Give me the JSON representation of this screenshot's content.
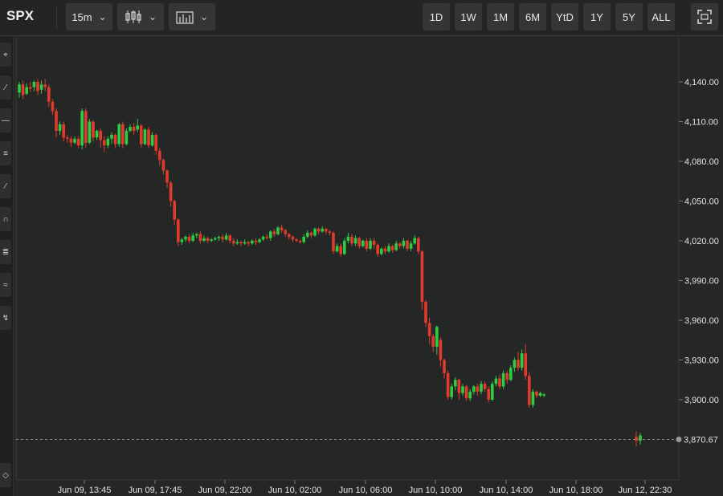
{
  "toolbar": {
    "symbol": "SPX",
    "interval": "15m",
    "candle_icon": "candlestick-icon",
    "indicator_icon": "indicators-icon",
    "ranges": [
      "1D",
      "1W",
      "1M",
      "6M",
      "YtD",
      "1Y",
      "5Y",
      "ALL"
    ],
    "fullscreen_icon": "fullscreen-icon"
  },
  "sidebar": {
    "tools": [
      "crosshair-icon",
      "trendline-icon",
      "horizontal-line-icon",
      "fibonacci-icon",
      "channel-icon",
      "arc-icon",
      "pitchfork-icon",
      "brush-icon",
      "annotation-icon"
    ],
    "bottom_tool": "eraser-icon"
  },
  "colors": {
    "up": "#2ecc40",
    "down": "#e23b2e",
    "background": "#252726"
  },
  "chart_data": {
    "type": "candlestick",
    "symbol": "SPX",
    "interval": "15m",
    "ylim": [
      3860,
      4150
    ],
    "yticks": [
      "4,140.00",
      "4,110.00",
      "4,080.00",
      "4,050.00",
      "4,020.00",
      "3,990.00",
      "3,960.00",
      "3,930.00",
      "3,900.00"
    ],
    "xticks": [
      "Jun 09, 13:45",
      "Jun 09, 17:45",
      "Jun 09, 22:00",
      "Jun 10, 02:00",
      "Jun 10, 06:00",
      "Jun 10, 10:00",
      "Jun 10, 14:00",
      "Jun 10, 18:00",
      "Jun 12, 22:30"
    ],
    "last_price_label": "3,870.67",
    "last_price": 3870,
    "candles": [
      [
        4132,
        4138,
        4128,
        4140
      ],
      [
        4138,
        4130,
        4127,
        4141
      ],
      [
        4131,
        4136,
        4130,
        4139
      ],
      [
        4136,
        4135,
        4132,
        4140
      ],
      [
        4136,
        4140,
        4133,
        4141
      ],
      [
        4140,
        4133,
        4130,
        4142
      ],
      [
        4134,
        4138,
        4131,
        4141
      ],
      [
        4138,
        4136,
        4133,
        4142
      ],
      [
        4136,
        4125,
        4121,
        4138
      ],
      [
        4125,
        4118,
        4115,
        4127
      ],
      [
        4118,
        4103,
        4098,
        4120
      ],
      [
        4103,
        4108,
        4100,
        4110
      ],
      [
        4108,
        4098,
        4095,
        4110
      ],
      [
        4098,
        4097,
        4094,
        4100
      ],
      [
        4097,
        4094,
        4091,
        4099
      ],
      [
        4094,
        4097,
        4093,
        4099
      ],
      [
        4097,
        4092,
        4090,
        4099
      ],
      [
        4092,
        4118,
        4089,
        4120
      ],
      [
        4118,
        4094,
        4090,
        4120
      ],
      [
        4094,
        4110,
        4093,
        4112
      ],
      [
        4110,
        4098,
        4095,
        4111
      ],
      [
        4098,
        4103,
        4096,
        4104
      ],
      [
        4103,
        4096,
        4090,
        4105
      ],
      [
        4096,
        4092,
        4087,
        4099
      ],
      [
        4092,
        4097,
        4090,
        4099
      ],
      [
        4097,
        4100,
        4093,
        4102
      ],
      [
        4100,
        4093,
        4090,
        4101
      ],
      [
        4093,
        4108,
        4091,
        4109
      ],
      [
        4108,
        4093,
        4090,
        4110
      ],
      [
        4093,
        4103,
        4092,
        4105
      ],
      [
        4103,
        4106,
        4102,
        4108
      ],
      [
        4106,
        4103,
        4100,
        4109
      ],
      [
        4104,
        4107,
        4102,
        4112
      ],
      [
        4107,
        4093,
        4090,
        4108
      ],
      [
        4093,
        4104,
        4092,
        4105
      ],
      [
        4104,
        4092,
        4090,
        4106
      ],
      [
        4092,
        4100,
        4091,
        4102
      ],
      [
        4100,
        4088,
        4085,
        4101
      ],
      [
        4088,
        4081,
        4077,
        4090
      ],
      [
        4081,
        4073,
        4070,
        4082
      ],
      [
        4073,
        4064,
        4060,
        4074
      ],
      [
        4064,
        4050,
        4046,
        4065
      ],
      [
        4050,
        4036,
        4032,
        4051
      ],
      [
        4036,
        4019,
        4016,
        4037
      ],
      [
        4019,
        4021,
        4017,
        4022
      ],
      [
        4021,
        4023,
        4019,
        4024
      ],
      [
        4023,
        4020,
        4018,
        4025
      ],
      [
        4020,
        4024,
        4019,
        4026
      ],
      [
        4024,
        4025,
        4022,
        4026
      ],
      [
        4025,
        4020,
        4018,
        4027
      ],
      [
        4020,
        4022,
        4019,
        4024
      ],
      [
        4022,
        4020,
        4018,
        4023
      ],
      [
        4020,
        4021,
        4019,
        4022
      ],
      [
        4021,
        4022,
        4020,
        4023
      ],
      [
        4022,
        4023,
        4020,
        4024
      ],
      [
        4023,
        4021,
        4019,
        4025
      ],
      [
        4021,
        4024,
        4020,
        4026
      ],
      [
        4024,
        4020,
        4018,
        4025
      ],
      [
        4020,
        4018,
        4016,
        4022
      ],
      [
        4018,
        4019,
        4017,
        4021
      ],
      [
        4019,
        4018,
        4016,
        4020
      ],
      [
        4018,
        4019,
        4017,
        4021
      ],
      [
        4019,
        4018,
        4016,
        4020
      ],
      [
        4018,
        4020,
        4017,
        4021
      ],
      [
        4020,
        4019,
        4017,
        4022
      ],
      [
        4019,
        4021,
        4018,
        4022
      ],
      [
        4021,
        4023,
        4020,
        4024
      ],
      [
        4023,
        4022,
        4021,
        4025
      ],
      [
        4022,
        4027,
        4020,
        4028
      ],
      [
        4027,
        4025,
        4023,
        4029
      ],
      [
        4025,
        4030,
        4024,
        4031
      ],
      [
        4030,
        4028,
        4026,
        4032
      ],
      [
        4028,
        4025,
        4023,
        4029
      ],
      [
        4025,
        4023,
        4021,
        4026
      ],
      [
        4023,
        4021,
        4019,
        4024
      ],
      [
        4021,
        4020,
        4019,
        4022
      ],
      [
        4020,
        4019,
        4018,
        4021
      ],
      [
        4019,
        4023,
        4018,
        4025
      ],
      [
        4023,
        4026,
        4022,
        4028
      ],
      [
        4026,
        4024,
        4022,
        4027
      ],
      [
        4024,
        4029,
        4023,
        4030
      ],
      [
        4029,
        4027,
        4025,
        4030
      ],
      [
        4027,
        4029,
        4026,
        4031
      ],
      [
        4029,
        4027,
        4025,
        4030
      ],
      [
        4027,
        4026,
        4024,
        4028
      ],
      [
        4026,
        4012,
        4010,
        4027
      ],
      [
        4012,
        4016,
        4011,
        4018
      ],
      [
        4016,
        4010,
        4008,
        4018
      ],
      [
        4010,
        4020,
        4009,
        4022
      ],
      [
        4020,
        4023,
        4018,
        4026
      ],
      [
        4023,
        4018,
        4016,
        4025
      ],
      [
        4018,
        4022,
        4016,
        4024
      ],
      [
        4022,
        4016,
        4014,
        4023
      ],
      [
        4016,
        4020,
        4015,
        4021
      ],
      [
        4020,
        4014,
        4012,
        4022
      ],
      [
        4014,
        4020,
        4013,
        4022
      ],
      [
        4020,
        4017,
        4014,
        4022
      ],
      [
        4017,
        4010,
        4008,
        4018
      ],
      [
        4010,
        4014,
        4009,
        4015
      ],
      [
        4014,
        4012,
        4010,
        4016
      ],
      [
        4012,
        4016,
        4011,
        4018
      ],
      [
        4016,
        4013,
        4011,
        4017
      ],
      [
        4013,
        4018,
        4012,
        4020
      ],
      [
        4018,
        4016,
        4014,
        4019
      ],
      [
        4016,
        4020,
        4014,
        4022
      ],
      [
        4020,
        4014,
        4012,
        4021
      ],
      [
        4014,
        4018,
        4012,
        4020
      ],
      [
        4018,
        4022,
        4017,
        4024
      ],
      [
        4022,
        4012,
        4010,
        4023
      ],
      [
        4012,
        3974,
        3968,
        4013
      ],
      [
        3974,
        3958,
        3955,
        3975
      ],
      [
        3958,
        3948,
        3942,
        3962
      ],
      [
        3948,
        3940,
        3936,
        3950
      ],
      [
        3940,
        3955,
        3934,
        3956
      ],
      [
        3945,
        3930,
        3925,
        3947
      ],
      [
        3930,
        3920,
        3916,
        3931
      ],
      [
        3920,
        3902,
        3900,
        3922
      ],
      [
        3902,
        3910,
        3900,
        3912
      ],
      [
        3910,
        3915,
        3907,
        3917
      ],
      [
        3915,
        3905,
        3900,
        3916
      ],
      [
        3905,
        3910,
        3903,
        3912
      ],
      [
        3910,
        3901,
        3899,
        3911
      ],
      [
        3901,
        3906,
        3899,
        3908
      ],
      [
        3906,
        3910,
        3904,
        3911
      ],
      [
        3910,
        3906,
        3903,
        3912
      ],
      [
        3906,
        3912,
        3904,
        3914
      ],
      [
        3912,
        3908,
        3906,
        3914
      ],
      [
        3908,
        3900,
        3898,
        3910
      ],
      [
        3900,
        3912,
        3899,
        3914
      ],
      [
        3912,
        3916,
        3910,
        3918
      ],
      [
        3916,
        3910,
        3908,
        3919
      ],
      [
        3910,
        3920,
        3908,
        3922
      ],
      [
        3920,
        3915,
        3912,
        3922
      ],
      [
        3915,
        3924,
        3914,
        3926
      ],
      [
        3924,
        3930,
        3921,
        3932
      ],
      [
        3930,
        3924,
        3922,
        3936
      ],
      [
        3924,
        3935,
        3922,
        3938
      ],
      [
        3935,
        3918,
        3915,
        3942
      ],
      [
        3918,
        3896,
        3894,
        3921
      ],
      [
        3896,
        3906,
        3894,
        3908
      ],
      [
        3906,
        3903,
        3901,
        3907
      ],
      [
        3903,
        3905,
        3902,
        3906
      ],
      [
        3904,
        3904,
        3902,
        3905
      ],
      [
        3872,
        3869,
        3865,
        3876
      ],
      [
        3869,
        3873,
        3866,
        3875
      ]
    ]
  }
}
